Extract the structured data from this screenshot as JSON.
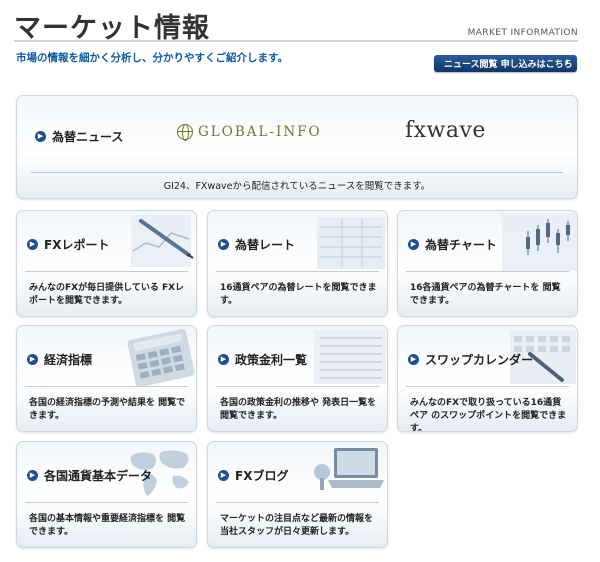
{
  "header": {
    "title": "マーケット情報",
    "subtitle": "MARKET INFORMATION",
    "lead": "市場の情報を細かく分析し、分かりやすくご紹介します。",
    "apply_button": "ニュース閲覧 申し込みはこちら"
  },
  "news": {
    "label": "為替ニュース",
    "logo_global": "GLOBAL-INFO",
    "logo_fx": "fxwave",
    "desc": "GI24、FXwaveから配信されているニュースを閲覧できます。"
  },
  "cards": [
    {
      "label": "FXレポート",
      "desc": "みんなのFXが毎日提供している FXレポートを閲覧できます。",
      "icon": "pen-on-chart-image"
    },
    {
      "label": "為替レート",
      "desc": "16通貨ペアの為替レートを閲覧できます。",
      "icon": "rate-table-image"
    },
    {
      "label": "為替チャート",
      "desc": "16各通貨ペアの為替チャートを 閲覧できます。",
      "icon": "candlestick-chart-image"
    },
    {
      "label": "経済指標",
      "desc": "各国の経済指標の予測や結果を 閲覧できます。",
      "icon": "calculator-image"
    },
    {
      "label": "政策金利一覧",
      "desc": "各国の政策金利の推移や 発表日一覧を閲覧できます。",
      "icon": "newspaper-image"
    },
    {
      "label": "スワップカレンダー",
      "desc": "みんなのFXで取り扱っている16通貨ペア のスワップポイントを閲覧できます。",
      "icon": "pen-on-calendar-image"
    },
    {
      "label": "各国通貨基本データ",
      "desc": "各国の基本情報や重要経済指標を 閲覧できます。",
      "icon": "world-map-image"
    },
    {
      "label": "FXブログ",
      "desc": "マーケットの注目点など最新の情報を 当社スタッフが日々更新します。",
      "icon": "laptop-image"
    }
  ],
  "colors": {
    "accent": "#0b5aa3",
    "button": "#1f4f8c",
    "global_logo": "#6b7b2a"
  }
}
